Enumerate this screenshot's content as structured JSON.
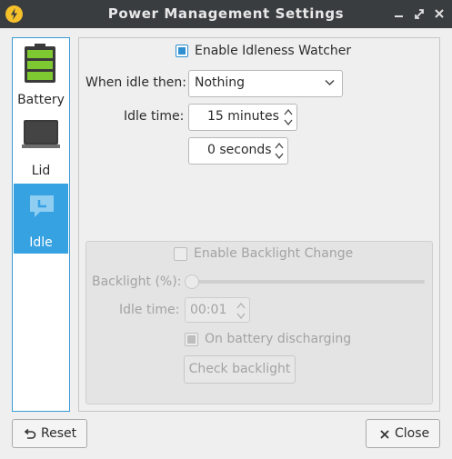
{
  "window": {
    "title": "Power Management Settings",
    "app_icon": "lightning-icon"
  },
  "sidebar": {
    "items": [
      {
        "label": "Battery",
        "icon": "battery-icon",
        "selected": false
      },
      {
        "label": "Lid",
        "icon": "laptop-icon",
        "selected": false
      },
      {
        "label": "Idle",
        "icon": "idle-chat-icon",
        "selected": true
      }
    ]
  },
  "idle": {
    "enable_label": "Enable Idleness Watcher",
    "enable_checked": true,
    "when_idle_label": "When idle then:",
    "when_idle_value": "Nothing",
    "idle_time_label": "Idle time:",
    "idle_minutes": "15 minutes",
    "idle_seconds": "0 seconds"
  },
  "backlight": {
    "enable_label": "Enable Backlight Change",
    "enable_checked": false,
    "percent_label": "Backlight (%):",
    "slider_value": 0,
    "idle_time_label": "Idle time:",
    "idle_time_value": "00:01",
    "on_battery_label": "On battery discharging",
    "on_battery_checked": true,
    "check_button": "Check backlight",
    "enabled": false
  },
  "footer": {
    "reset_label": "Reset",
    "close_label": "Close"
  },
  "colors": {
    "accent": "#36a2e2",
    "titlebar": "#3a3d40",
    "battery_green": "#7ec832"
  }
}
